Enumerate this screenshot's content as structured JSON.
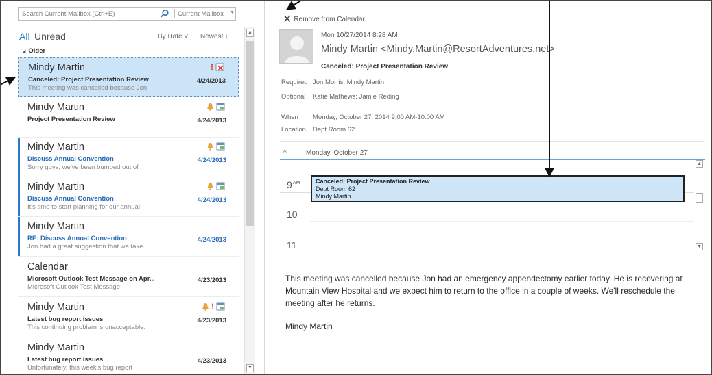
{
  "search": {
    "placeholder": "Search Current Mailbox (Ctrl+E)",
    "scope": "Current Mailbox"
  },
  "filter": {
    "all": "All",
    "unread": "Unread",
    "sort_by": "By Date ˅",
    "sort_order": "Newest ↓"
  },
  "group": {
    "label": "Older"
  },
  "mail_items": [
    {
      "sender": "Mindy Martin",
      "subject": "Canceled: Project Presentation Review",
      "preview": "This meeting was cancelled because Jon",
      "date": "4/24/2013",
      "selected": true,
      "unread": false,
      "icons": [
        "important-icon",
        "meeting-cancelled-icon"
      ]
    },
    {
      "sender": "Mindy Martin",
      "subject": "Project Presentation Review",
      "preview": "",
      "date": "4/24/2013",
      "selected": false,
      "unread": false,
      "icons": [
        "reminder-bell-icon",
        "meeting-request-icon"
      ]
    },
    {
      "sender": "Mindy Martin",
      "subject": "Discuss Annual Convention",
      "preview": "Sorry guys, we've been bumped out of",
      "date": "4/24/2013",
      "selected": false,
      "unread": true,
      "icons": [
        "reminder-bell-icon",
        "meeting-request-icon"
      ]
    },
    {
      "sender": "Mindy Martin",
      "subject": "Discuss Annual Convention",
      "preview": "It's time to start planning for our annual",
      "date": "4/24/2013",
      "selected": false,
      "unread": true,
      "icons": [
        "reminder-bell-icon",
        "meeting-request-icon"
      ]
    },
    {
      "sender": "Mindy Martin",
      "subject": "RE: Discuss Annual Convention",
      "preview": "Jon had a great suggestion that we take",
      "date": "4/24/2013",
      "selected": false,
      "unread": true,
      "icons": []
    },
    {
      "sender": "Calendar",
      "subject": "Microsoft Outlook Test Message on Apr...",
      "preview": "Microsoft Outlook Test Message",
      "date": "4/23/2013",
      "selected": false,
      "unread": false,
      "icons": []
    },
    {
      "sender": "Mindy Martin",
      "subject": "Latest bug report issues",
      "preview": "This continuing problem is unacceptable.",
      "date": "4/23/2013",
      "selected": false,
      "unread": false,
      "icons": [
        "reminder-bell-icon",
        "important-icon",
        "meeting-request-icon"
      ]
    },
    {
      "sender": "Mindy Martin",
      "subject": "Latest bug report issues",
      "preview": "Unfortunately, this week's bug report",
      "date": "4/23/2013",
      "selected": false,
      "unread": false,
      "icons": []
    }
  ],
  "reading": {
    "remove_label": "Remove from Calendar",
    "datetime": "Mon 10/27/2014 8:28 AM",
    "from": "Mindy Martin <Mindy.Martin@ResortAdventures.net>",
    "subject": "Canceled: Project Presentation Review",
    "required_label": "Required",
    "required_value": "Jon Morris; Mindy Martin",
    "optional_label": "Optional",
    "optional_value": "Katie Mathews; Jamie Reding",
    "when_label": "When",
    "when_value": "Monday, October 27, 2014 9:00 AM-10:00 AM",
    "location_label": "Location",
    "location_value": "Dept Room 62"
  },
  "calendar": {
    "day_label": "Monday, October 27",
    "hours": [
      {
        "num": "9",
        "suffix": "AM"
      },
      {
        "num": "10",
        "suffix": ""
      },
      {
        "num": "11",
        "suffix": ""
      }
    ],
    "event": {
      "title": "Canceled: Project Presentation Review",
      "location": "Dept Room 62",
      "organizer": "Mindy Martin"
    }
  },
  "body": {
    "text": "This meeting was cancelled because Jon had an emergency appendectomy earlier today. He is recovering at Mountain View Hospital and we expect him to return to the office in a couple of weeks. We'll reschedule the meeting after he returns.",
    "signature": "Mindy Martin"
  },
  "colors": {
    "accent": "#2a7ac9",
    "selection": "#cce4f7",
    "event_fill": "#cfe6f8",
    "important": "#e23b2a",
    "bell": "#e8a23a"
  }
}
